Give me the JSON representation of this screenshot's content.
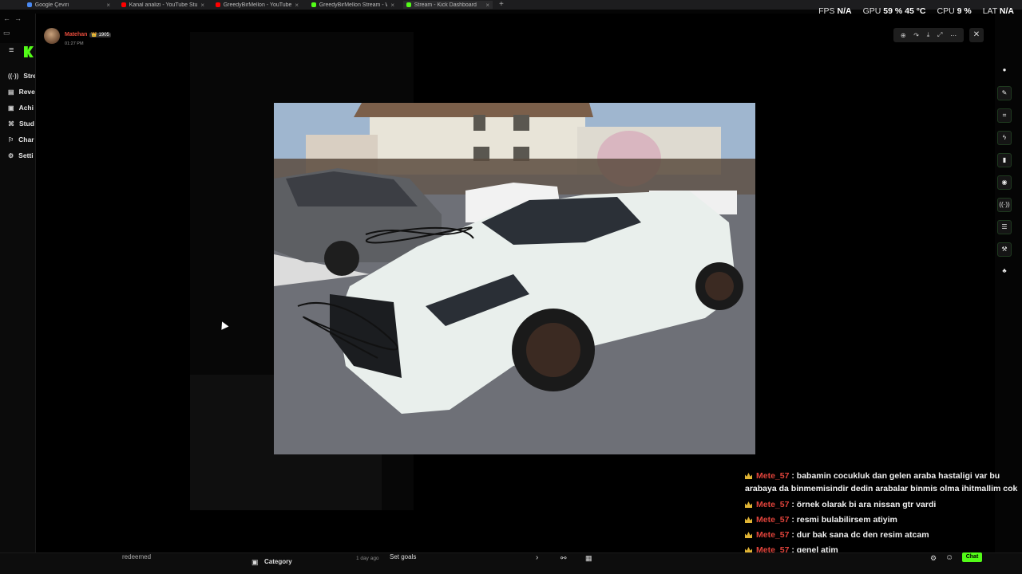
{
  "browser": {
    "tabs": [
      {
        "label": "Google Çeviri",
        "color": "#4a8af4"
      },
      {
        "label": "Kanal analizi - YouTube Studio",
        "color": "#ff0000"
      },
      {
        "label": "GreedyBirMellon - YouTube",
        "color": "#ff0000"
      },
      {
        "label": "GreedyBirMellon Stream - Watch",
        "color": "#53fc18"
      },
      {
        "label": "Stream - Kick Dashboard",
        "color": "#53fc18"
      }
    ],
    "new_tab": "+"
  },
  "stats": {
    "fps_label": "FPS",
    "fps_value": "N/A",
    "gpu_label": "GPU",
    "gpu_value": "59 % 45 °C",
    "cpu_label": "CPU",
    "cpu_value": "9 %",
    "lat_label": "LAT",
    "lat_value": "N/A"
  },
  "sidebar": {
    "items": [
      {
        "icon": "((·))",
        "label": "Strea"
      },
      {
        "icon": "▤",
        "label": "Reve"
      },
      {
        "icon": "▣",
        "label": "Achi"
      },
      {
        "icon": "⌘",
        "label": "Stud"
      },
      {
        "icon": "⚐",
        "label": "Char"
      },
      {
        "icon": "⚙",
        "label": "Setti"
      }
    ]
  },
  "viewer": {
    "poster_name": "Matehan",
    "poster_badge": "👑 1905",
    "poster_time": "01:27 PM",
    "tools": [
      "⊕",
      "↷",
      "⤓",
      "⤢",
      "⋯"
    ],
    "close": "✕"
  },
  "chat": {
    "messages": [
      {
        "user": "Mete_57",
        "text": "babamin cocukluk dan gelen araba hastaligi var bu arabaya da binmemisindir dedin arabalar binmis olma ihitmallim cok"
      },
      {
        "user": "Mete_57",
        "text": "örnek olarak bi ara nissan gtr vardi"
      },
      {
        "user": "Mete_57",
        "text": "resmi bulabilirsem atiyim"
      },
      {
        "user": "Mete_57",
        "text": "dur bak sana dc den resim atcam"
      },
      {
        "user": "Mete_57",
        "text": "genel atim"
      }
    ]
  },
  "bottom": {
    "redeemed": "redeemed",
    "category_label": "Category",
    "ago": "1 day ago",
    "goals": "Set goals",
    "chat_button": "Chat"
  }
}
